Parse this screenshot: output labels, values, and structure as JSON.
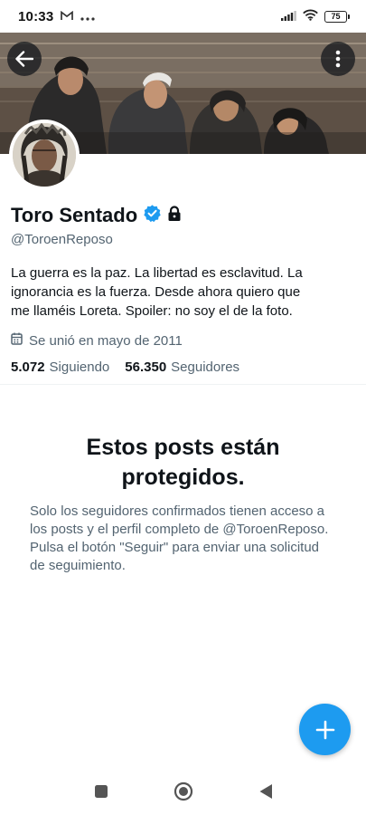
{
  "status_bar": {
    "time": "10:33",
    "battery": "75",
    "icons": [
      "gmail-icon",
      "more-dots-icon",
      "signal-icon",
      "wifi-icon",
      "battery-icon"
    ]
  },
  "header": {
    "back_icon": "arrow-left-icon",
    "more_icon": "more-vertical-icon"
  },
  "profile": {
    "display_name": "Toro Sentado",
    "handle": "@ToroenReposo",
    "verified": true,
    "protected": true,
    "bio": "La guerra es la paz. La libertad es esclavitud. La ignorancia es la fuerza.  Desde ahora quiero que me llaméis Loreta.  Spoiler: no soy el de la foto.",
    "joined": "Se unió en mayo de 2011",
    "following_count": "5.072",
    "following_label": "Siguiendo",
    "followers_count": "56.350",
    "followers_label": "Seguidores"
  },
  "protected_notice": {
    "title": "Estos posts están protegidos.",
    "body": "Solo los seguidores confirmados tienen acceso a los posts y el perfil completo de @ToroenReposo. Pulsa el botón \"Seguir\" para enviar una solicitud de seguimiento."
  },
  "fab": {
    "icon": "plus-icon"
  },
  "colors": {
    "accent": "#1d9bf0",
    "text_primary": "#0f1419",
    "text_secondary": "#536471"
  }
}
